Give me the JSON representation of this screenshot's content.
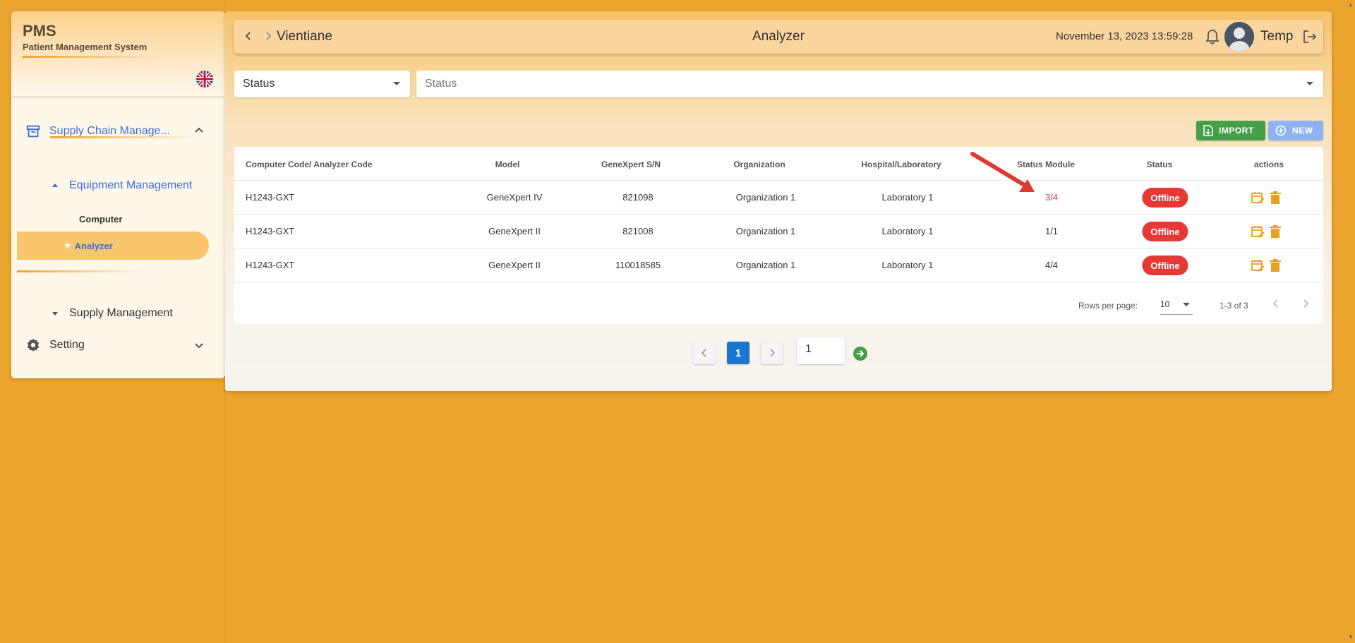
{
  "app": {
    "abbr": "PMS",
    "name": "Patient Management System",
    "language_icon": "uk-flag-icon"
  },
  "sidebar": {
    "items": [
      {
        "label": "Supply Chain Manage...",
        "icon": "archive-icon",
        "expanded": true
      },
      {
        "label": "Equipment Management",
        "icon": "caret-up-icon",
        "expanded": true
      },
      {
        "label": "Computer"
      },
      {
        "label": "Analyzer",
        "icon": "star-icon",
        "active": true
      },
      {
        "label": "Supply Management",
        "icon": "caret-down-icon"
      },
      {
        "label": "Setting",
        "icon": "gear-icon",
        "expanded": false
      }
    ]
  },
  "topbar": {
    "location": "Vientiane",
    "title": "Analyzer",
    "datetime": "November 13, 2023 13:59:28",
    "user": "Temp"
  },
  "filters": {
    "status_filter": "Status",
    "status_placeholder": "Status"
  },
  "actions": {
    "import_label": "IMPORT",
    "new_label": "NEW"
  },
  "table": {
    "columns": [
      "Computer Code/ Analyzer Code",
      "Model",
      "GeneXpert S/N",
      "Organization",
      "Hospital/Laboratory",
      "Status Module",
      "Status",
      "actions"
    ],
    "rows": [
      {
        "code": "H1243-GXT",
        "model": "GeneXpert IV",
        "sn": "821098",
        "org": "Organization 1",
        "lab": "Laboratory 1",
        "module": "3/4",
        "status": "Offline",
        "highlight": true
      },
      {
        "code": "H1243-GXT",
        "model": "GeneXpert II",
        "sn": "821008",
        "org": "Organization 1",
        "lab": "Laboratory 1",
        "module": "1/1",
        "status": "Offline"
      },
      {
        "code": "H1243-GXT",
        "model": "GeneXpert II",
        "sn": "110018585",
        "org": "Organization 1",
        "lab": "Laboratory 1",
        "module": "4/4",
        "status": "Offline"
      }
    ],
    "rows_per_page_label": "Rows per page:",
    "rows_per_page": "10",
    "range": "1-3 of 3"
  },
  "pagination": {
    "current": "1",
    "goto_value": "1"
  },
  "colors": {
    "background": "#eba42e",
    "accent_blue": "#3a6fd8",
    "offline_red": "#e53935",
    "import_green": "#43a047",
    "new_blue": "#8fb3f0",
    "page_blue": "#1976d2"
  }
}
